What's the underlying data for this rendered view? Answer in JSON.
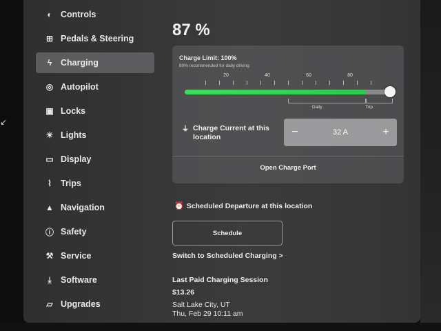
{
  "sidebar": {
    "items": [
      {
        "label": "Controls",
        "icon": "toggle-icon",
        "glyph": "◐"
      },
      {
        "label": "Pedals & Steering",
        "icon": "car-icon",
        "glyph": "⊞"
      },
      {
        "label": "Charging",
        "icon": "lightning-icon",
        "glyph": "ϟ",
        "active": true
      },
      {
        "label": "Autopilot",
        "icon": "steering-wheel-icon",
        "glyph": "◎"
      },
      {
        "label": "Locks",
        "icon": "lock-icon",
        "glyph": "▣"
      },
      {
        "label": "Lights",
        "icon": "sun-icon",
        "glyph": "☀"
      },
      {
        "label": "Display",
        "icon": "display-icon",
        "glyph": "▭"
      },
      {
        "label": "Trips",
        "icon": "trips-icon",
        "glyph": "⌇"
      },
      {
        "label": "Navigation",
        "icon": "navigation-arrow-icon",
        "glyph": "▲"
      },
      {
        "label": "Safety",
        "icon": "info-icon",
        "glyph": "ⓘ"
      },
      {
        "label": "Service",
        "icon": "wrench-icon",
        "glyph": "⚒"
      },
      {
        "label": "Software",
        "icon": "download-icon",
        "glyph": "⤓"
      },
      {
        "label": "Upgrades",
        "icon": "bag-icon",
        "glyph": "▱"
      }
    ]
  },
  "battery": {
    "percent_text": "87 %"
  },
  "charge_limit": {
    "title": "Charge Limit: 100%",
    "subtitle": "80% recommended for daily driving",
    "value_percent": 100,
    "current_fill_percent": 87,
    "tick_labels": [
      "20",
      "40",
      "60",
      "80"
    ],
    "daily_label": "Daily",
    "trip_label": "Trip"
  },
  "charge_current": {
    "label": "Charge Current at this location",
    "value": "32 A",
    "minus": "−",
    "plus": "+"
  },
  "open_port_label": "Open Charge Port",
  "scheduled": {
    "title": "Scheduled Departure at this location",
    "schedule_button": "Schedule",
    "switch_link": "Switch to Scheduled Charging >"
  },
  "last_session": {
    "title": "Last Paid Charging Session",
    "amount": "$13.26",
    "location": "Salt Lake City, UT",
    "time": "Thu, Feb 29 10:11 am"
  },
  "colors": {
    "charge_fill": "#3ddc5a",
    "active_nav": "#5c5c5e"
  }
}
